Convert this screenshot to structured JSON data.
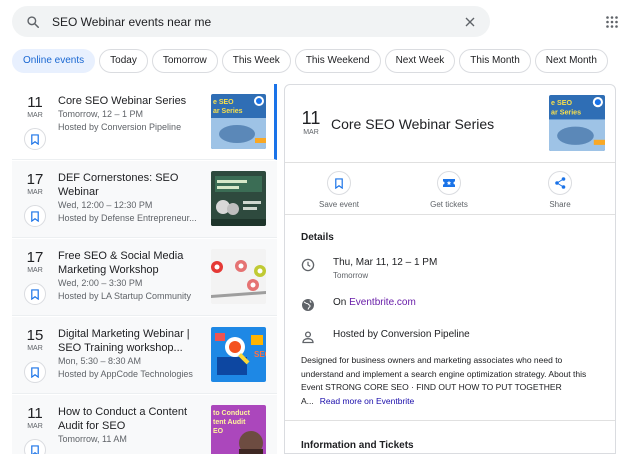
{
  "search": {
    "query": "SEO Webinar events near me"
  },
  "chips": [
    "Online events",
    "Today",
    "Tomorrow",
    "This Week",
    "This Weekend",
    "Next Week",
    "This Month",
    "Next Month"
  ],
  "events": [
    {
      "day": "11",
      "month": "MAR",
      "title": "Core SEO Webinar Series",
      "line1": "Tomorrow, 12 – 1 PM",
      "line2": "Hosted by Conversion Pipeline"
    },
    {
      "day": "17",
      "month": "MAR",
      "title": "DEF Cornerstones: SEO Webinar",
      "line1": "Wed, 12:00 – 12:30 PM",
      "line2": "Hosted by Defense Entrepreneur..."
    },
    {
      "day": "17",
      "month": "MAR",
      "title": "Free SEO & Social Media Marketing Workshop",
      "line1": "Wed, 2:00 – 3:30 PM",
      "line2": "Hosted by LA Startup Community"
    },
    {
      "day": "15",
      "month": "MAR",
      "title": "Digital Marketing Webinar | SEO Training workshop...",
      "line1": "Mon, 5:30 – 8:30 AM",
      "line2": "Hosted by AppCode Technologies"
    },
    {
      "day": "11",
      "month": "MAR",
      "title": "How to Conduct a Content Audit for SEO",
      "line1": "Tomorrow, 11 AM",
      "line2": ""
    }
  ],
  "detail": {
    "day": "11",
    "month": "MAR",
    "title": "Core SEO Webinar Series",
    "actions": {
      "save": "Save event",
      "tickets": "Get tickets",
      "share": "Share"
    },
    "details_heading": "Details",
    "when": "Thu, Mar 11, 12 – 1 PM",
    "when_sub": "Tomorrow",
    "on_prefix": "On ",
    "on_site": "Eventbrite.com",
    "host": "Hosted by Conversion Pipeline",
    "description": "Designed for business owners and marketing associates who need to understand and implement a search engine optimization strategy. About this Event STRONG CORE SEO · FIND OUT HOW TO PUT TOGETHER A...",
    "read_more": "Read more on Eventbrite",
    "info_heading": "Information and Tickets"
  },
  "thumbs": {
    "t1_text": "e SEO\nar Series",
    "t3_text": "to Conduct\ntent Audit\nEO",
    "t4_text": "SEO"
  },
  "colors": {
    "accent": "#1a73e8",
    "chip_active_bg": "#e8f0fe",
    "link_purple": "#681da8"
  }
}
